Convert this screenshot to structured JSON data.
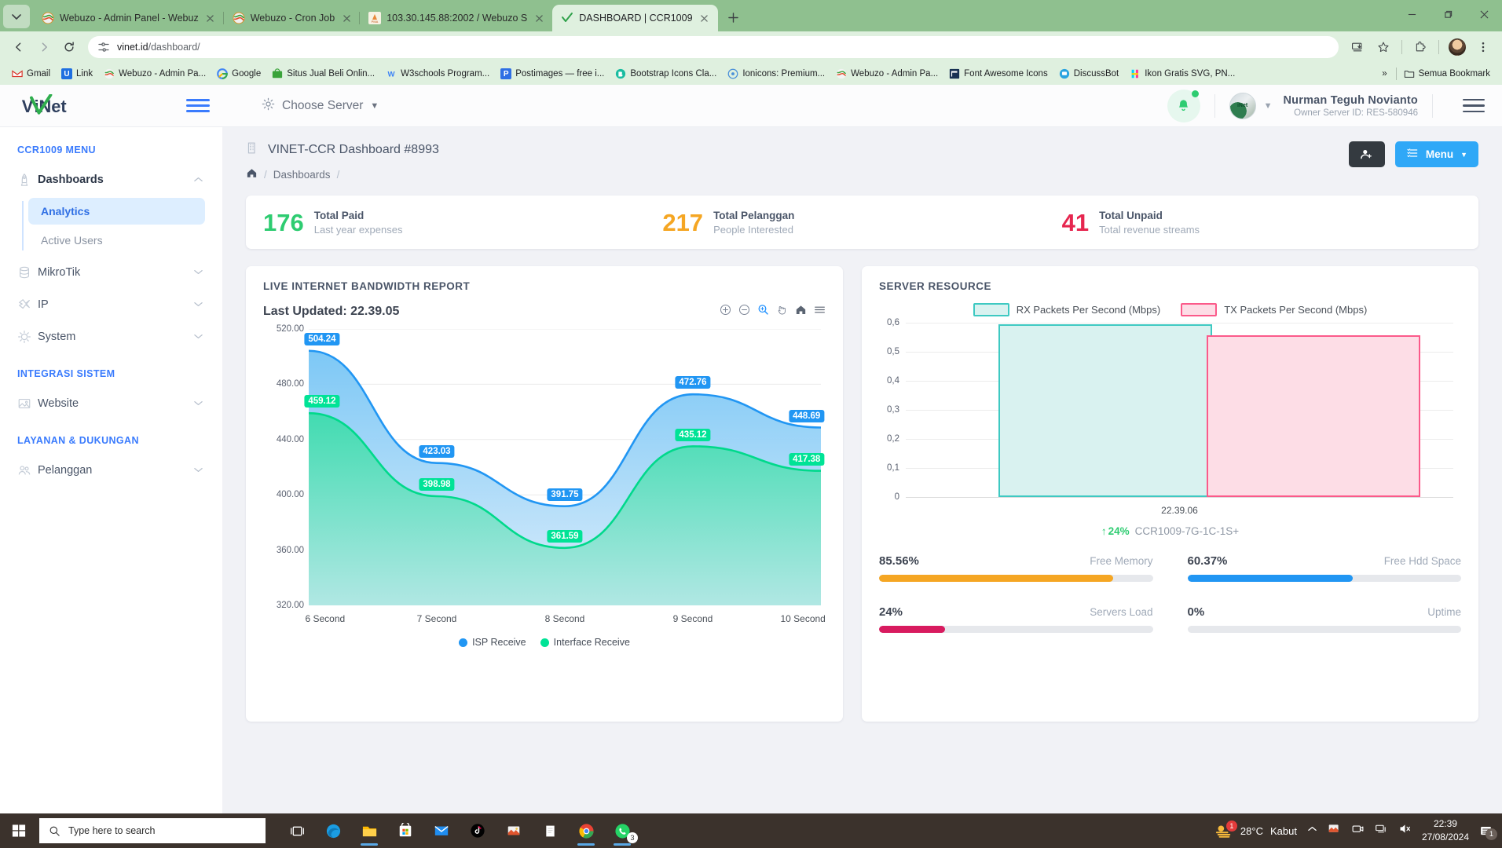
{
  "browser": {
    "tabs": [
      {
        "title": "Webuzo - Admin Panel - Webuz",
        "favicon": "webuzo-icon",
        "active": false
      },
      {
        "title": "Webuzo - Cron Job",
        "favicon": "webuzo-icon",
        "active": false
      },
      {
        "title": "103.30.145.88:2002 / Webuzo S",
        "favicon": "phpmyadmin-icon",
        "active": false
      },
      {
        "title": "DASHBOARD | CCR1009",
        "favicon": "check-icon",
        "active": true
      }
    ],
    "url_host": "vinet.id",
    "url_path": "/dashboard/",
    "bookmarks": [
      {
        "label": "Gmail",
        "icon": "gmail-icon"
      },
      {
        "label": "Link",
        "icon": "link-icon"
      },
      {
        "label": "Webuzo - Admin Pa...",
        "icon": "webuzo-icon"
      },
      {
        "label": "Google",
        "icon": "google-icon"
      },
      {
        "label": "Situs Jual Beli Onlin...",
        "icon": "tokopedia-icon"
      },
      {
        "label": "W3schools Program...",
        "icon": "w3schools-icon"
      },
      {
        "label": "Postimages — free i...",
        "icon": "postimages-icon"
      },
      {
        "label": "Bootstrap Icons Cla...",
        "icon": "bootstrap-icon"
      },
      {
        "label": "Ionicons: Premium...",
        "icon": "ionicons-icon"
      },
      {
        "label": "Webuzo - Admin Pa...",
        "icon": "webuzo-icon"
      },
      {
        "label": "Font Awesome Icons",
        "icon": "fontawesome-icon"
      },
      {
        "label": "DiscussBot",
        "icon": "discussbot-icon"
      },
      {
        "label": "Ikon Gratis SVG, PN...",
        "icon": "flaticon-icon"
      }
    ],
    "overflow_label": "»",
    "all_bookmarks_label": "Semua Bookmark"
  },
  "topbar": {
    "logo_text": "iNet",
    "choose_server": "Choose Server",
    "user_name": "Nurman Teguh Novianto",
    "user_sub": "Owner Server ID: RES-580946"
  },
  "sidebar": {
    "section1": "CCR1009 MENU",
    "items": [
      {
        "label": "Dashboards",
        "icon": "rocket-icon",
        "expanded": true
      },
      {
        "label": "MikroTik",
        "icon": "database-icon",
        "expanded": false
      },
      {
        "label": "IP",
        "icon": "pin-icon",
        "expanded": false
      },
      {
        "label": "System",
        "icon": "gear-icon",
        "expanded": false
      }
    ],
    "sub_items": [
      {
        "label": "Analytics",
        "active": true
      },
      {
        "label": "Active Users",
        "active": false
      }
    ],
    "section2": "INTEGRASI SISTEM",
    "items2": [
      {
        "label": "Website",
        "icon": "image-icon",
        "expanded": false
      }
    ],
    "section3": "LAYANAN & DUKUNGAN",
    "items3": [
      {
        "label": "Pelanggan",
        "icon": "users-icon",
        "expanded": false
      }
    ]
  },
  "page": {
    "title": "VINET-CCR Dashboard #8993",
    "breadcrumb_home": "home-icon",
    "breadcrumb_1": "Dashboards",
    "slash": "/",
    "add_user_label": "add-user-icon",
    "menu_label": "Menu"
  },
  "stats": [
    {
      "num": "176",
      "title": "Total Paid",
      "sub": "Last year expenses",
      "color": "#2ecc71"
    },
    {
      "num": "217",
      "title": "Total Pelanggan",
      "sub": "People Interested",
      "color": "#f5a623"
    },
    {
      "num": "41",
      "title": "Total Unpaid",
      "sub": "Total revenue streams",
      "color": "#e6264f"
    }
  ],
  "bandwidth_panel": {
    "title": "LIVE INTERNET BANDWIDTH REPORT",
    "last_updated": "Last Updated: 22.39.05",
    "tools": [
      "zoom-in-icon",
      "zoom-out-icon",
      "selection-zoom-icon",
      "pan-icon",
      "reset-home-icon",
      "menu-icon"
    ]
  },
  "server_panel": {
    "title": "SERVER RESOURCE",
    "timestamp": "22.39.06",
    "rate_pct": "24%",
    "device": "CCR1009-7G-1C-1S+",
    "meters": [
      {
        "value": "85.56%",
        "label": "Free Memory",
        "pct": 85.56,
        "color": "#f5a623"
      },
      {
        "value": "60.37%",
        "label": "Free Hdd Space",
        "pct": 60.37,
        "color": "#2196f3"
      },
      {
        "value": "24%",
        "label": "Servers Load",
        "pct": 24,
        "color": "#d81b5f"
      },
      {
        "value": "0%",
        "label": "Uptime",
        "pct": 0,
        "color": "#2ecc71"
      }
    ]
  },
  "chart_data": [
    {
      "type": "area",
      "title": "LIVE INTERNET BANDWIDTH REPORT",
      "xlabel": "",
      "ylabel": "",
      "categories": [
        "6 Second",
        "7 Second",
        "8 Second",
        "9 Second",
        "10 Second"
      ],
      "ylim": [
        320,
        520
      ],
      "yticks": [
        320,
        360,
        400,
        440,
        480,
        520
      ],
      "ytick_labels": [
        "320.00",
        "360.00",
        "400.00",
        "440.00",
        "480.00",
        "520.00"
      ],
      "grid": true,
      "legend_position": "bottom",
      "series": [
        {
          "name": "ISP Receive",
          "color": "#2196f3",
          "values": [
            504.24,
            423.03,
            391.75,
            472.76,
            448.69
          ],
          "labels": [
            "504.24",
            "423.03",
            "391.75",
            "472.76",
            "448.69"
          ]
        },
        {
          "name": "Interface Receive",
          "color": "#00e396",
          "values": [
            459.12,
            398.98,
            361.59,
            435.12,
            417.38
          ],
          "labels": [
            "459.12",
            "398.98",
            "361.59",
            "435.12",
            "417.38"
          ]
        }
      ]
    },
    {
      "type": "bar",
      "title": "SERVER RESOURCE",
      "categories": [
        "22.39.06"
      ],
      "ylim": [
        0,
        0.6
      ],
      "yticks": [
        0,
        0.1,
        0.2,
        0.3,
        0.4,
        0.5,
        0.6
      ],
      "ytick_labels": [
        "0",
        "0,1",
        "0,2",
        "0,3",
        "0,4",
        "0,5",
        "0,6"
      ],
      "grid": true,
      "legend_position": "top",
      "series": [
        {
          "name": "RX Packets Per Second (Mbps)",
          "color": "#3ec9c2",
          "fill": "#d9f2f0",
          "values": [
            0.595
          ]
        },
        {
          "name": "TX Packets Per Second (Mbps)",
          "color": "#fb5a8a",
          "fill": "#fddde6",
          "values": [
            0.558
          ]
        }
      ]
    }
  ],
  "taskbar": {
    "search_placeholder": "Type here to search",
    "weather_temp": "28°C",
    "weather_desc": "Kabut",
    "time": "22:39",
    "date": "27/08/2024",
    "whatsapp_badge": "3",
    "notif_badge": "1",
    "weather_badge": "1",
    "apps": [
      "task-view-icon",
      "edge-icon",
      "file-explorer-icon",
      "microsoft-store-icon",
      "mail-icon",
      "tiktok-icon",
      "photos-icon",
      "notepad-icon",
      "chrome-icon",
      "whatsapp-icon"
    ]
  }
}
